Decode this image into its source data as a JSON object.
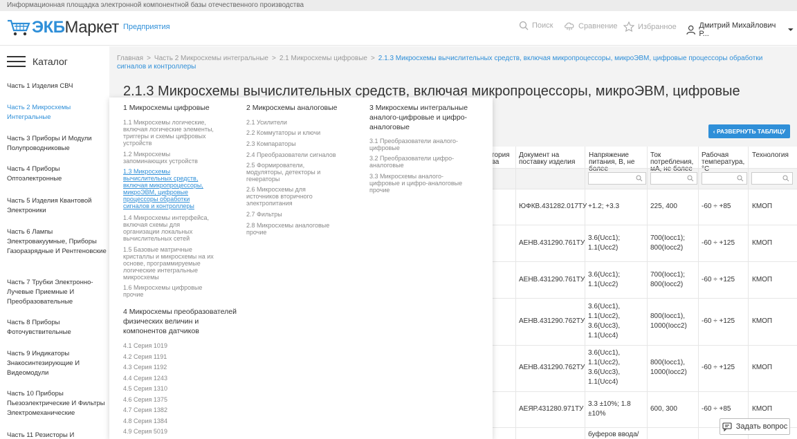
{
  "topbar": {
    "text": "Информационная площадка электронной компонентной базы отечественного производства"
  },
  "header": {
    "logo_ekb": "ЭКБ",
    "logo_market": "Маркет",
    "nav_enterprises": "Предприятия",
    "search_label": "Поиск",
    "compare_label": "Сравнение",
    "favorites_label": "Избранное",
    "user_name": "Дмитрий Михайлович Р..."
  },
  "sidebar": {
    "title": "Каталог",
    "items": [
      {
        "label": "Часть 1 Изделия СВЧ"
      },
      {
        "label": "Часть 2 Микросхемы Интегральные"
      },
      {
        "label": "Часть 3 Приборы И Модули Полупроводниковые"
      },
      {
        "label": "Часть 4 Приборы Оптоэлектронные"
      },
      {
        "label": "Часть 5 Изделия Квантовой Электроники"
      },
      {
        "label": "Часть 6 Лампы Электровакуумные, Приборы Газоразрядные И Рентгеновские"
      },
      {
        "label": "Часть 7 Трубки Электронно-Лучевые Приемные И Преобразовательные"
      },
      {
        "label": "Часть 8 Приборы Фоточувствительные"
      },
      {
        "label": "Часть 9 Индикаторы Знакосинтезирующие И Видеомодули"
      },
      {
        "label": "Часть 10 Приборы Пьезоэлектрические И Фильтры Электромеханические"
      },
      {
        "label": "Часть 11 Резисторы И"
      }
    ]
  },
  "breadcrumb": {
    "home": "Главная",
    "part": "Часть 2 Микросхемы интегральные",
    "section": "2.1 Микросхемы цифровые",
    "current": "2.1.3 Микросхемы вычислительных средств, включая микропроцессоры, микроЭВМ, цифровые процессоры обработки сигналов и контроллеры"
  },
  "page_title": "2.1.3 Микросхемы вычислительных средств, включая микропроцессоры, микроЭВМ, цифровые",
  "expand_button": "‹ РАЗВЕРНУТЬ ТАБЛИЦУ",
  "table": {
    "headers": {
      "category": "тегория\nства",
      "doc": "Документ на\nпоставку изделия",
      "voltage": "Напряжение\nпитания, В, не\nболее",
      "current": "Ток\nпотребления,\nмА, не более",
      "temp": "Рабочая\nтемпература,\n°С",
      "tech": "Технология"
    },
    "rows": [
      {
        "doc": "ЮФКВ.431282.017ТУ",
        "voltage": "+1.2; +3.3",
        "current": "225, 400",
        "temp": "-60 ÷ +85",
        "tech": "КМОП"
      },
      {
        "doc": "АЕНВ.431290.761ТУ",
        "voltage": "3.6(Ucc1);\n1.1(Ucc2)",
        "current": "700(Iocc1);\n800(Iocc2)",
        "temp": "-60 ÷ +125",
        "tech": "КМОП"
      },
      {
        "doc": "АЕНВ.431290.761ТУ",
        "voltage": "3.6(Ucc1);\n1.1(Ucc2)",
        "current": "700(Iocc1);\n800(Iocc2)",
        "temp": "-60 ÷ +125",
        "tech": "КМОП"
      },
      {
        "doc": "АЕНВ.431290.762ТУ",
        "voltage": "3.6(Ucc1),\n1.1(Ucc2),\n3.6(Ucc3),\n1.1(Ucc4)",
        "current": "800(Iocc1),\n1000(Iocc2)",
        "temp": "-60 ÷ +125",
        "tech": "КМОП"
      },
      {
        "doc": "АЕНВ.431290.762ТУ",
        "voltage": "3.6(Ucc1),\n1.1(Ucc2),\n3.6(Ucc3),\n1.1(Ucc4)",
        "current": "800(Iocc1),\n1000(Iocc2)",
        "temp": "-60 ÷ +125",
        "tech": "КМОП"
      },
      {
        "doc": "АЕЯР.431280.971ТУ",
        "voltage": "3.3 ±10%; 1.8\n±10%",
        "current": "600, 300",
        "temp": "-60 ÷ +85",
        "tech": "КМОП"
      },
      {
        "doc": "",
        "voltage": "буферов ввода/",
        "current": "",
        "temp": "",
        "tech": ""
      }
    ]
  },
  "mega_menu": {
    "col1_head": "1 Микросхемы цифровые",
    "col1_links": [
      "1.1 Микросхемы логические,\nвключая логические элементы,\nтриггеры и схемы цифровых\nустройств",
      "1.2 Микросхемы\nзапоминающих устройств",
      "1.3 Микросхемы\nвычислительных средств,\nвключая микропроцессоры,\nмикроЭВМ, цифровые\nпроцессоры обработки\nсигналов и контроллеры",
      "1.4 Микросхемы интерфейса,\nвключая схемы для\nорганизации локальных\nвычислительных сетей",
      "1.5 Базовые матричные\nкристаллы и микросхемы на их\nоснове, программируемые\nлогические интегральные\nмикросхемы",
      "1.6 Микросхемы цифровые\nпрочие"
    ],
    "col1b_head": "4 Микросхемы преобразователей\nфизических величин и\nкомпонентов датчиков",
    "col1b_links": [
      "4.1 Серия 1019",
      "4.2 Серия 1191",
      "4.3 Серия 1192",
      "4.4 Серия 1243",
      "4.5 Серия 1310",
      "4.6 Серия 1375",
      "4.7 Серия 1382",
      "4.8 Серия 1384",
      "4.9 Серия 5019"
    ],
    "col2_head": "2 Микросхемы аналоговые",
    "col2_links": [
      "2.1 Усилители",
      "2.2 Коммутаторы и ключи",
      "2.3 Компараторы",
      "2.4 Преобразователи сигналов",
      "2.5 Формирователи,\nмодуляторы, детекторы и\nгенераторы",
      "2.6 Микросхемы для\nисточников вторичного\nэлектропитания",
      "2.7 Фильтры",
      "2.8 Микросхемы аналоговые\nпрочие"
    ],
    "col3_head": "3 Микросхемы интегральные\nаналого-цифровые и цифро-\nаналоговые",
    "col3_links": [
      "3.1 Преобразователи аналого-\nцифровые",
      "3.2 Преобразователи цифро-\nаналоговые",
      "3.3 Микросхемы аналого-\nцифровые и цифро-аналоговые\nпрочие"
    ]
  },
  "ask_button": "Задать вопрос",
  "colors": {
    "accent": "#2f8fd8",
    "topbar": "#ececec",
    "content_bg": "#f3f3f3"
  }
}
